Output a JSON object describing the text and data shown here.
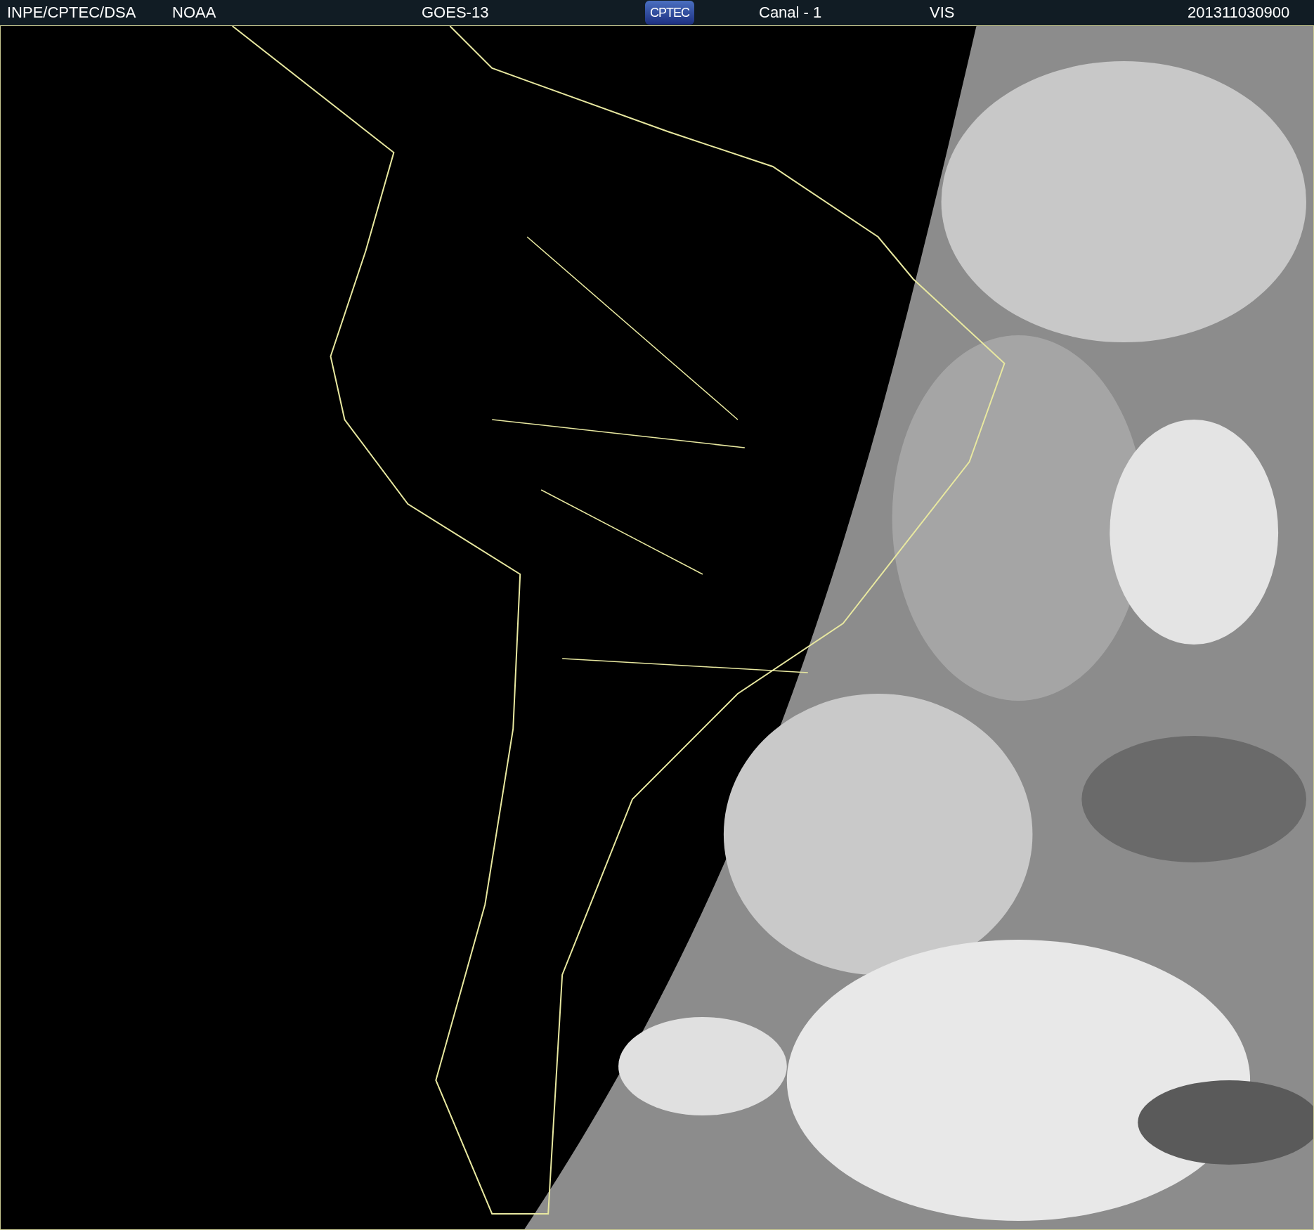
{
  "header": {
    "agency": "INPE/CPTEC/DSA",
    "source": "NOAA",
    "satellite": "GOES-13",
    "logo": "CPTEC",
    "channel": "Canal - 1",
    "band": "VIS",
    "timestamp": "201311030900"
  }
}
